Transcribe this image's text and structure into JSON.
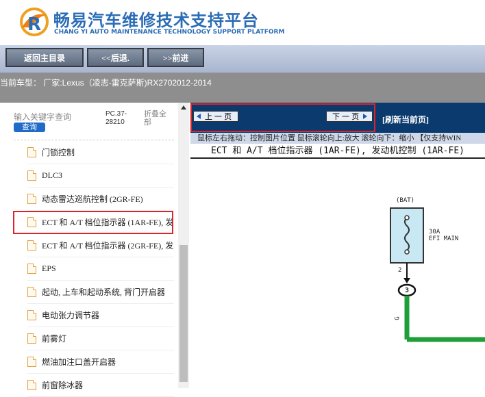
{
  "brand": {
    "title_cn": "畅易汽车维修技术支持平台",
    "title_en": "CHANG YI AUTO MAINTENANCE TECHNOLOGY SUPPORT PLATFORM"
  },
  "nav": {
    "back_main": "返回主目录",
    "back": "<<后退.",
    "forward": ">>前进"
  },
  "status": {
    "current_model": "当前车型： 厂家:Lexus（凌志-雷克萨斯)RX2702012-2014"
  },
  "sidebar": {
    "search_placeholder": "输入关键字查询",
    "search_button": "查询",
    "pc_number": "PC.37-28210",
    "collapse_all": "折叠全部",
    "items": [
      {
        "label": "门锁控制"
      },
      {
        "label": "DLC3"
      },
      {
        "label": "动态雷达巡航控制 (2GR-FE)"
      },
      {
        "label": "ECT 和 A/T 档位指示器 (1AR-FE), 发"
      },
      {
        "label": "ECT 和 A/T 档位指示器 (2GR-FE), 发"
      },
      {
        "label": "EPS"
      },
      {
        "label": "起动, 上车和起动系统, 背门开启器"
      },
      {
        "label": "电动张力调节器"
      },
      {
        "label": "前雾灯"
      },
      {
        "label": "燃油加注口盖开启器"
      },
      {
        "label": "前窗除冰器"
      }
    ],
    "selected_index": 3
  },
  "viewer": {
    "prev_page": "上 一 页",
    "next_page": "下 一 页",
    "refresh": "[刷新当前页]",
    "hint": "鼠标左右拖动：控制图片位置 鼠标滚轮向上:放大  滚轮向下：缩小 【仅支持WIN",
    "doc_title": "ECT 和 A/T 档位指示器 (1AR-FE), 发动机控制 (1AR-FE)"
  },
  "diagram": {
    "bat_label": "(BAT)",
    "fuse_amp": "30A",
    "fuse_name": "EFI MAIN",
    "pin_number": "2",
    "connector_number": "3",
    "wire_color": "G",
    "wire_color_hex": "#1f9e3a"
  },
  "colors": {
    "brand_blue": "#2b6cb5",
    "highlight_red": "#d9262c",
    "viewer_bar": "#0a3a6e"
  }
}
